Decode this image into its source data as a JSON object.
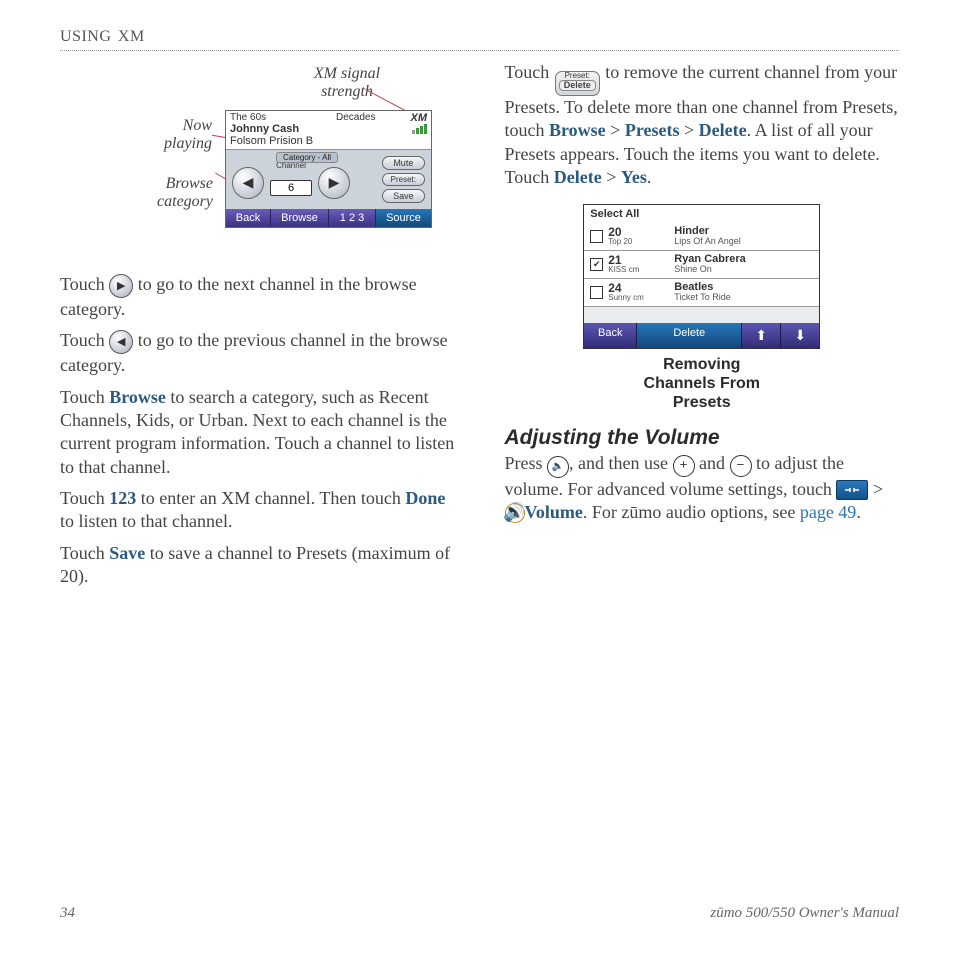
{
  "header": {
    "section_small": "U",
    "section_rest": "SING",
    "topic": "XM"
  },
  "callouts": {
    "sig": "XM signal strength",
    "now": "Now playing",
    "browse": "Browse category"
  },
  "screen1": {
    "genre": "The 60s",
    "decades": "Decades",
    "xm": "XM",
    "artist": "Johnny Cash",
    "song": "Folsom Prision B",
    "cat_label": "Category - All",
    "channel_label": "Channel",
    "channel_value": "6",
    "mute": "Mute",
    "preset": "Preset:",
    "save": "Save",
    "back": "Back",
    "browse": "Browse",
    "onetwothree": "1 2 3",
    "source": "Source"
  },
  "left_paras": {
    "p1a": "Touch ",
    "p1b": " to go to the next channel in the browse category.",
    "p2a": "Touch ",
    "p2b": " to go to the previous channel in the browse category.",
    "p3a": "Touch ",
    "p3_browse": "Browse",
    "p3b": " to search a category, such as Recent Channels, Kids, or Urban. Next to each channel is the current program information. Touch a channel to listen to that channel.",
    "p4a": "Touch ",
    "p4_123": "123",
    "p4b": " to enter an XM channel. Then touch ",
    "p4_done": "Done",
    "p4c": " to listen to that channel.",
    "p5a": "Touch ",
    "p5_save": "Save",
    "p5b": " to save a channel to Presets (maximum of 20)."
  },
  "delete_pill": {
    "top": "Preset:",
    "btn": "Delete"
  },
  "right_paras": {
    "r1a": "Touch ",
    "r1b": " to remove the current channel from your Presets. To delete more than one channel from Presets, touch ",
    "r1_browse": "Browse",
    "gt": " > ",
    "r1_presets": "Presets",
    "r1_delete": "Delete",
    "r1c": ". A list of all your Presets appears. Touch the items you want to delete. Touch ",
    "r1_delete2": "Delete",
    "r1_yes": "Yes",
    "r1d": "."
  },
  "screen2": {
    "select_all": "Select All",
    "rows": [
      {
        "chan": "20",
        "genre": "Top 20",
        "artist": "Hinder",
        "track": "Lips Of An Angel",
        "checked": false
      },
      {
        "chan": "21",
        "genre": "KISS cm",
        "artist": "Ryan Cabrera",
        "track": "Shine On",
        "checked": true
      },
      {
        "chan": "24",
        "genre": "Sunny cm",
        "artist": "Beatles",
        "track": "Ticket To Ride",
        "checked": false
      }
    ],
    "back": "Back",
    "delete": "Delete"
  },
  "fig2cap_l1": "Removing",
  "fig2cap_l2": "Channels From",
  "fig2cap_l3": "Presets",
  "volume": {
    "heading": "Adjusting the Volume",
    "s1": "Press ",
    "s2": ", and then use ",
    "s3": " and ",
    "s4": " to adjust the volume. For advanced volume settings, touch ",
    "s5": " > ",
    "s6": "Volume",
    "s7": ". For zūmo audio options, see ",
    "s8": "page 49",
    "s9": "."
  },
  "footer": {
    "page": "34",
    "manual": "zūmo 500/550 Owner's Manual"
  }
}
